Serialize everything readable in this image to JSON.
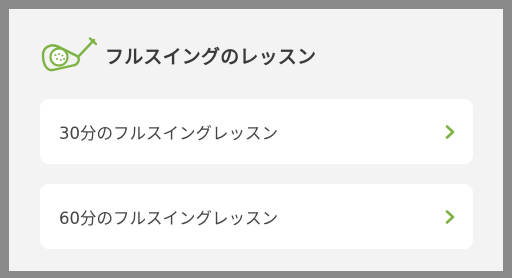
{
  "colors": {
    "accent": "#7cb342",
    "title": "#3a3a3a",
    "text": "#444444",
    "background": "#f3f3f3",
    "card": "#ffffff"
  },
  "header": {
    "icon": "golf-club-ball-icon",
    "title": "フルスイングのレッスン"
  },
  "lessons": [
    {
      "label": "30分のフルスイングレッスン",
      "icon": "chevron-right-icon"
    },
    {
      "label": "60分のフルスイングレッスン",
      "icon": "chevron-right-icon"
    }
  ]
}
